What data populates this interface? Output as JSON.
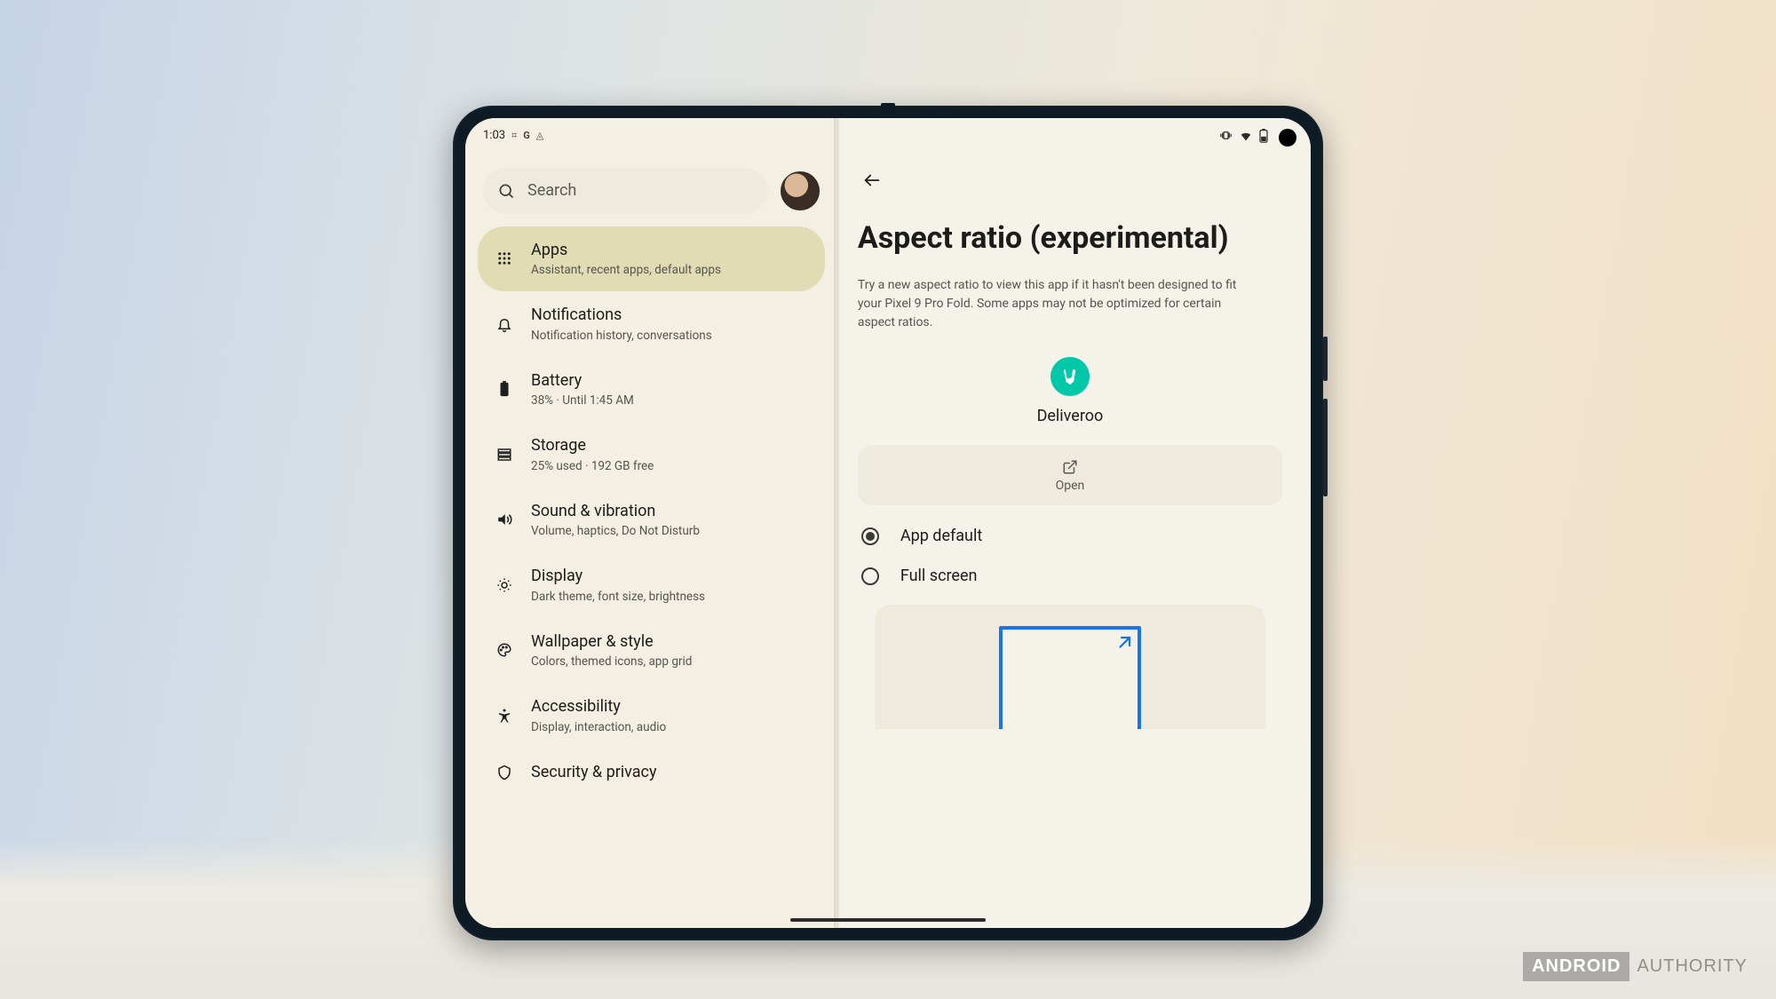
{
  "status_bar": {
    "time": "1:03",
    "left_icons": [
      "slack-icon",
      "google-icon",
      "snapseed-icon"
    ],
    "right_icons": [
      "vibrate-icon",
      "wifi-icon",
      "battery-icon"
    ]
  },
  "search": {
    "placeholder": "Search"
  },
  "settings_list": [
    {
      "icon": "apps-grid-icon",
      "title": "Apps",
      "subtitle": "Assistant, recent apps, default apps",
      "active": true
    },
    {
      "icon": "bell-icon",
      "title": "Notifications",
      "subtitle": "Notification history, conversations"
    },
    {
      "icon": "battery-icon",
      "title": "Battery",
      "subtitle": "38% · Until 1:45 AM"
    },
    {
      "icon": "storage-icon",
      "title": "Storage",
      "subtitle": "25% used · 192 GB free"
    },
    {
      "icon": "sound-icon",
      "title": "Sound & vibration",
      "subtitle": "Volume, haptics, Do Not Disturb"
    },
    {
      "icon": "display-icon",
      "title": "Display",
      "subtitle": "Dark theme, font size, brightness"
    },
    {
      "icon": "palette-icon",
      "title": "Wallpaper & style",
      "subtitle": "Colors, themed icons, app grid"
    },
    {
      "icon": "accessibility-icon",
      "title": "Accessibility",
      "subtitle": "Display, interaction, audio"
    },
    {
      "icon": "security-icon",
      "title": "Security & privacy",
      "subtitle": ""
    }
  ],
  "detail": {
    "title": "Aspect ratio (experimental)",
    "description": "Try a new aspect ratio to view this app if it hasn't been designed to fit your Pixel 9 Pro Fold. Some apps may not be optimized for certain aspect ratios.",
    "app_name": "Deliveroo",
    "open_label": "Open",
    "radio_options": [
      {
        "label": "App default",
        "selected": true
      },
      {
        "label": "Full screen",
        "selected": false
      }
    ]
  },
  "watermark": {
    "brand_boxed": "ANDROID",
    "brand_rest": "AUTHORITY"
  },
  "colors": {
    "accent_teal": "#00c8a8",
    "accent_blue": "#1a73e8",
    "active_pill": "#e1dcb4"
  }
}
